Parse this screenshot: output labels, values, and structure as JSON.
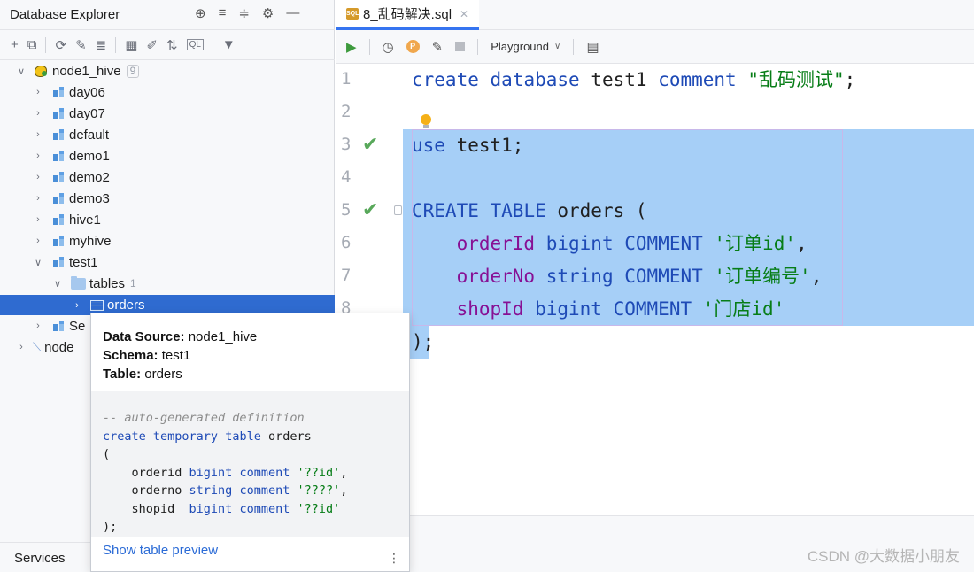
{
  "left_panel": {
    "title": "Database Explorer",
    "header_icons": [
      "⊕",
      "≡",
      "≑",
      "⚙",
      "—"
    ],
    "toolbar_icons": [
      "+",
      "⧉",
      "⟳",
      "✎",
      "≣",
      "▦",
      "✐",
      "⇅",
      "QL",
      "▼"
    ],
    "tree": {
      "root": {
        "label": "node1_hive",
        "count": "9"
      },
      "databases": [
        "day06",
        "day07",
        "default",
        "demo1",
        "demo2",
        "demo3",
        "hive1",
        "myhive"
      ],
      "expanded_db": "test1",
      "tables_folder": {
        "label": "tables",
        "count": "1"
      },
      "selected_table": "orders",
      "server_objects_label": "Se",
      "second_datasource_label": "node"
    },
    "services_label": "Services"
  },
  "editor": {
    "tab_label": "8_乱码解决.sql",
    "tab_icon_text": "SQL",
    "playground_label": "Playground",
    "lines": [
      {
        "n": "1",
        "segments": [
          [
            "kw",
            "create "
          ],
          [
            "kw",
            "database "
          ],
          [
            "plain",
            "test1 "
          ],
          [
            "kw",
            "comment "
          ],
          [
            "str",
            "\"乱码测试\""
          ],
          [
            "plain",
            ";"
          ]
        ]
      },
      {
        "n": "2",
        "segments": []
      },
      {
        "n": "3",
        "segments": [
          [
            "kw",
            "use "
          ],
          [
            "plain",
            "test1;"
          ]
        ]
      },
      {
        "n": "4",
        "segments": []
      },
      {
        "n": "5",
        "segments": [
          [
            "kw",
            "CREATE "
          ],
          [
            "kw",
            "TABLE "
          ],
          [
            "plain",
            "orders ("
          ]
        ]
      },
      {
        "n": "6",
        "segments": [
          [
            "plain",
            "    "
          ],
          [
            "fld",
            "orderId "
          ],
          [
            "kw",
            "bigint "
          ],
          [
            "kw",
            "COMMENT "
          ],
          [
            "str",
            "'订单id'"
          ],
          [
            "plain",
            ","
          ]
        ]
      },
      {
        "n": "7",
        "segments": [
          [
            "plain",
            "    "
          ],
          [
            "fld",
            "orderNo "
          ],
          [
            "kw",
            "string "
          ],
          [
            "kw",
            "COMMENT "
          ],
          [
            "str",
            "'订单编号'"
          ],
          [
            "plain",
            ","
          ]
        ]
      },
      {
        "n": "8",
        "segments": [
          [
            "plain",
            "    "
          ],
          [
            "fld",
            "shopId "
          ],
          [
            "kw",
            "bigint "
          ],
          [
            "kw",
            "COMMENT "
          ],
          [
            "str",
            "'门店id'"
          ]
        ]
      },
      {
        "n": "",
        "segments": [
          [
            "plain",
            ");"
          ]
        ]
      }
    ]
  },
  "popup": {
    "datasource_key": "Data Source:",
    "datasource_val": " node1_hive",
    "schema_key": "Schema:",
    "schema_val": " test1",
    "table_key": "Table:",
    "table_val": " orders",
    "code_lines": [
      [
        [
          "cm",
          "-- auto-generated definition"
        ]
      ],
      [
        [
          "k",
          "create "
        ],
        [
          "k",
          "temporary "
        ],
        [
          "k",
          "table "
        ],
        [
          "n",
          "orders"
        ]
      ],
      [
        [
          "n",
          "("
        ]
      ],
      [
        [
          "n",
          "    orderid "
        ],
        [
          "k",
          "bigint "
        ],
        [
          "k",
          "comment "
        ],
        [
          "s",
          "'??id'"
        ],
        [
          "n",
          ","
        ]
      ],
      [
        [
          "n",
          "    orderno "
        ],
        [
          "k",
          "string "
        ],
        [
          "k",
          "comment "
        ],
        [
          "s",
          "'????'"
        ],
        [
          "n",
          ","
        ]
      ],
      [
        [
          "n",
          "    shopid  "
        ],
        [
          "k",
          "bigint "
        ],
        [
          "k",
          "comment "
        ],
        [
          "s",
          "'??id'"
        ]
      ],
      [
        [
          "n",
          ");"
        ]
      ]
    ],
    "preview_link": "Show table preview",
    "more_icon": "⋮"
  },
  "watermark": "CSDN @大数据小朋友",
  "colors": {
    "selection": "#a6cff7",
    "selected_row": "#2f6bd0",
    "keyword": "#1e4ab6",
    "string": "#077d17",
    "field": "#871094"
  }
}
